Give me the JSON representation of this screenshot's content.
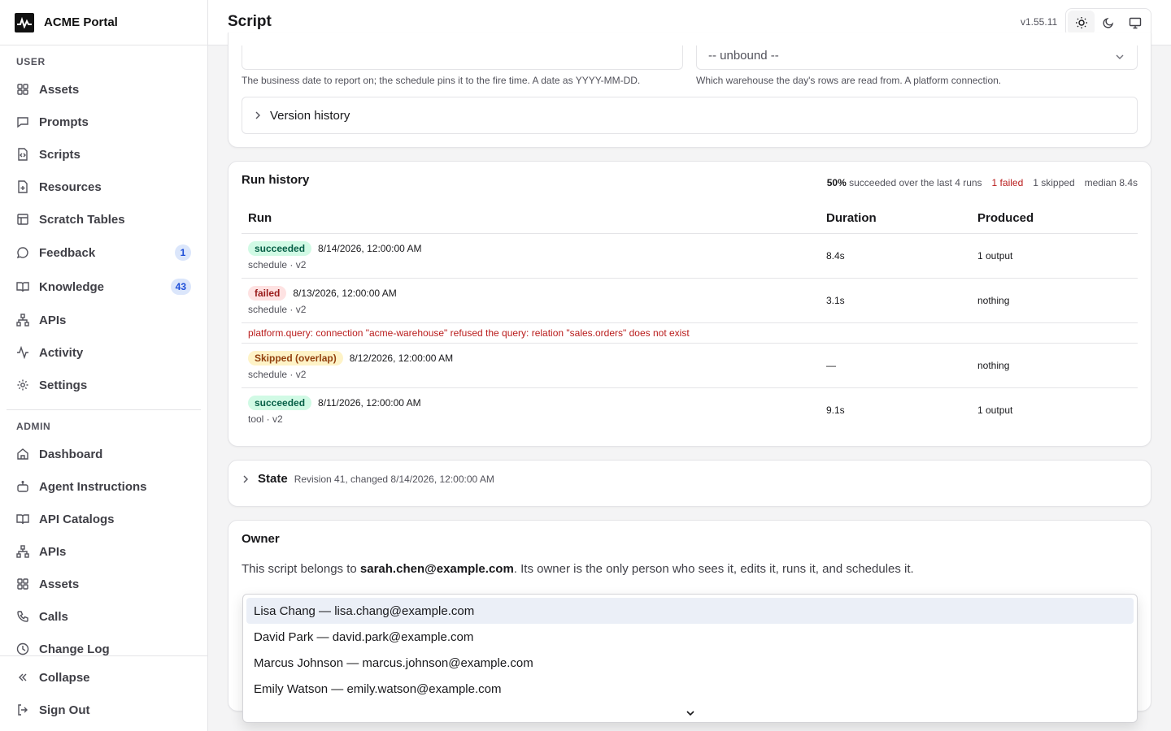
{
  "app": {
    "name": "ACME Portal"
  },
  "header": {
    "title": "Script",
    "version": "v1.55.11"
  },
  "sidebar": {
    "user_label": "USER",
    "user_items": [
      {
        "label": "Assets",
        "icon": "grid-icon"
      },
      {
        "label": "Prompts",
        "icon": "message-square-icon"
      },
      {
        "label": "Scripts",
        "icon": "file-code-icon"
      },
      {
        "label": "Resources",
        "icon": "file-plus-icon"
      },
      {
        "label": "Scratch Tables",
        "icon": "table-icon"
      },
      {
        "label": "Feedback",
        "icon": "message-circle-icon",
        "badge": "1"
      },
      {
        "label": "Knowledge",
        "icon": "book-open-icon",
        "badge": "43"
      },
      {
        "label": "APIs",
        "icon": "network-icon"
      },
      {
        "label": "Activity",
        "icon": "activity-icon"
      },
      {
        "label": "Settings",
        "icon": "gear-icon"
      }
    ],
    "admin_label": "ADMIN",
    "admin_items": [
      {
        "label": "Dashboard",
        "icon": "home-icon"
      },
      {
        "label": "Agent Instructions",
        "icon": "bot-icon"
      },
      {
        "label": "API Catalogs",
        "icon": "book-open-icon"
      },
      {
        "label": "APIs",
        "icon": "network-icon"
      },
      {
        "label": "Assets",
        "icon": "grid-icon"
      },
      {
        "label": "Calls",
        "icon": "phone-icon"
      },
      {
        "label": "Change Log",
        "icon": "clock-icon"
      }
    ],
    "collapse_label": "Collapse",
    "signout_label": "Sign Out"
  },
  "params": {
    "date_help": "The business date to report on; the schedule pins it to the fire time. A date as YYYY-MM-DD.",
    "warehouse_value": "-- unbound --",
    "warehouse_help": "Which warehouse the day's rows are read from. A platform connection.",
    "version_history_label": "Version history"
  },
  "run_history": {
    "title": "Run history",
    "summary_rate": "50%",
    "summary_rest": "succeeded over the last 4 runs",
    "summary_failed": "1 failed",
    "summary_skipped": "1 skipped",
    "summary_median": "median 8.4s",
    "columns": [
      "Run",
      "Duration",
      "Produced"
    ],
    "runs": [
      {
        "status": "succeeded",
        "time": "8/14/2026, 12:00:00 AM",
        "sub": "schedule · v2",
        "duration": "8.4s",
        "produced": "1 output"
      },
      {
        "status": "failed",
        "time": "8/13/2026, 12:00:00 AM",
        "sub": "schedule · v2",
        "duration": "3.1s",
        "produced": "nothing",
        "error": "platform.query: connection \"acme-warehouse\" refused the query: relation \"sales.orders\" does not exist"
      },
      {
        "status": "Skipped (overlap)",
        "time": "8/12/2026, 12:00:00 AM",
        "sub": "schedule · v2",
        "duration": "—",
        "produced": "nothing"
      },
      {
        "status": "succeeded",
        "time": "8/11/2026, 12:00:00 AM",
        "sub": "tool · v2",
        "duration": "9.1s",
        "produced": "1 output"
      }
    ]
  },
  "state": {
    "title": "State",
    "meta": "Revision 41, changed 8/14/2026, 12:00:00 AM"
  },
  "owner": {
    "title": "Owner",
    "desc_prefix": "This script belongs to ",
    "email": "sarah.chen@example.com",
    "desc_suffix": ". Its owner is the only person who sees it, edits it, runs it, and schedules it.",
    "options": [
      "Lisa Chang — lisa.chang@example.com",
      "David Park — david.park@example.com",
      "Marcus Johnson — marcus.johnson@example.com",
      "Emily Watson — emily.watson@example.com"
    ]
  },
  "colors": {
    "success_bg": "#d1fae5",
    "fail_bg": "#fee2e2",
    "skip_bg": "#fef3c7",
    "error_text": "#b91c1c",
    "badge_bg": "#dbe6fb"
  }
}
